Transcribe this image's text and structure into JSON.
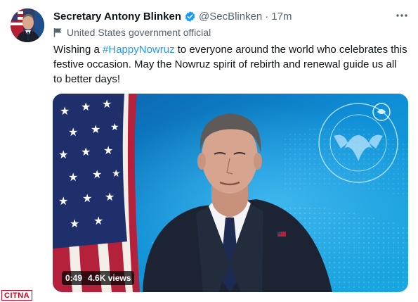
{
  "tweet": {
    "author_name": "Secretary Antony Blinken",
    "handle": "@SecBlinken",
    "separator": "·",
    "time": "17m",
    "label": "United States government official",
    "text_before": "Wishing a ",
    "hashtag": "#HappyNowruz",
    "text_after": " to everyone around the world who celebrates this festive occasion. May the Nowruz spirit of rebirth and renewal guide us all to better days!",
    "icons": {
      "verified": "verified-badge-icon",
      "more": "more-options-icon",
      "label": "government-flag-icon"
    },
    "colors": {
      "link": "#1d9bf0",
      "secondary_text": "#536471",
      "verified": "#1d9bf0"
    }
  },
  "video": {
    "duration": "0:49",
    "views": "4.6K views"
  },
  "watermark": {
    "text": "CITNA"
  }
}
